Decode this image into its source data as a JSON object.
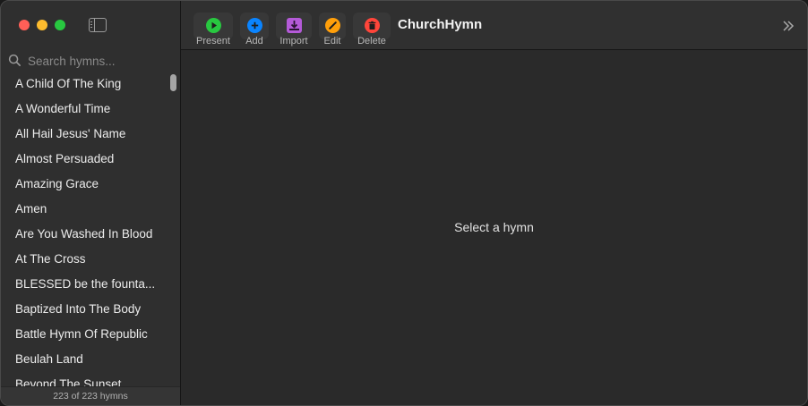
{
  "app": {
    "title": "ChurchHymn"
  },
  "search": {
    "placeholder": "Search hymns..."
  },
  "toolbar": {
    "present_label": "Present",
    "add_label": "Add",
    "import_label": "Import",
    "edit_label": "Edit",
    "delete_label": "Delete"
  },
  "icons": {
    "present": {
      "name": "play-icon",
      "color": "#28c840"
    },
    "add": {
      "name": "plus-icon",
      "color": "#0a84ff"
    },
    "import": {
      "name": "import-tray-icon",
      "color": "#b45ad8"
    },
    "edit": {
      "name": "pencil-icon",
      "color": "#ff9f0a"
    },
    "delete": {
      "name": "trash-icon",
      "color": "#ff453a"
    }
  },
  "hymns": [
    "A Child Of The King",
    "A Wonderful Time",
    "All Hail Jesus' Name",
    "Almost Persuaded",
    "Amazing Grace",
    "Amen",
    "Are You Washed In Blood",
    "At The Cross",
    "BLESSED be the founta...",
    "Baptized Into The Body",
    "Battle Hymn Of Republic",
    "Beulah Land",
    "Beyond The Sunset"
  ],
  "footer": {
    "count_text": "223 of 223 hymns"
  },
  "detail": {
    "empty_message": "Select a hymn"
  }
}
